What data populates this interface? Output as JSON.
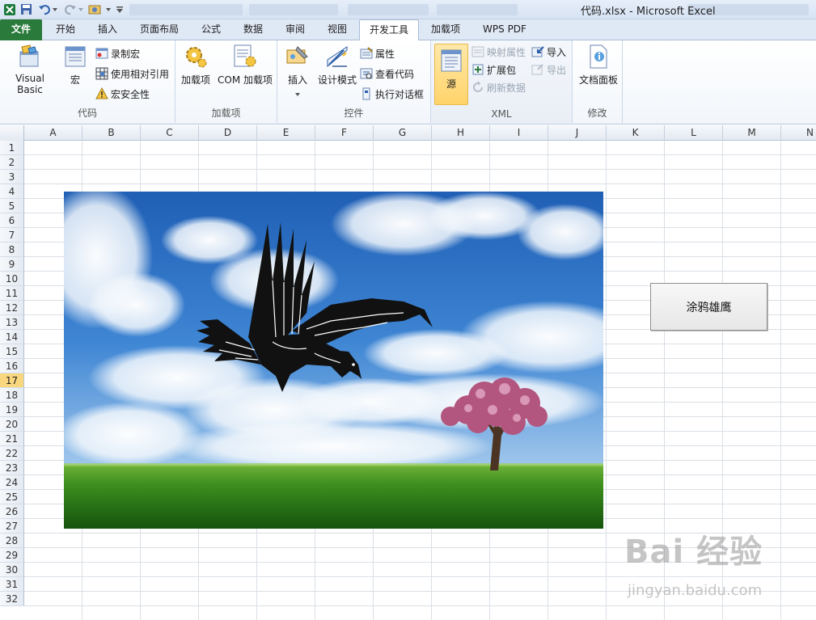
{
  "titlebar": {
    "title": "代码.xlsx  -  Microsoft Excel"
  },
  "tabs": {
    "file": "文件",
    "items": [
      "开始",
      "插入",
      "页面布局",
      "公式",
      "数据",
      "审阅",
      "视图",
      "开发工具",
      "加载项",
      "WPS PDF"
    ],
    "active": "开发工具"
  },
  "ribbon": {
    "code": {
      "label": "代码",
      "visual_basic": "Visual Basic",
      "macros": "宏",
      "record_macro": "录制宏",
      "use_relative": "使用相对引用",
      "macro_security": "宏安全性"
    },
    "addins": {
      "label": "加载项",
      "addins": "加载项",
      "com_addins": "COM 加载项"
    },
    "controls": {
      "label": "控件",
      "insert": "插入",
      "design_mode": "设计模式",
      "properties": "属性",
      "view_code": "查看代码",
      "run_dialog": "执行对话框"
    },
    "xml": {
      "label": "XML",
      "source": "源",
      "map_properties": "映射属性",
      "expansion_packs": "扩展包",
      "refresh_data": "刷新数据",
      "import": "导入",
      "export": "导出"
    },
    "modify": {
      "label": "修改",
      "document_panel": "文档面板"
    }
  },
  "grid": {
    "columns": [
      "A",
      "B",
      "C",
      "D",
      "E",
      "F",
      "G",
      "H",
      "I",
      "J",
      "K",
      "L",
      "M",
      "N"
    ],
    "rows": [
      "1",
      "2",
      "3",
      "4",
      "5",
      "6",
      "7",
      "8",
      "9",
      "10",
      "11",
      "12",
      "13",
      "14",
      "15",
      "16",
      "17",
      "18",
      "19",
      "20",
      "21",
      "22",
      "23",
      "24",
      "25",
      "26",
      "27",
      "28",
      "29",
      "30",
      "31",
      "32"
    ],
    "selected_row": "17"
  },
  "sheet": {
    "macro_button_label": "涂鸦雄鹰"
  },
  "watermark": {
    "brand": "Bai 经验",
    "url": "jingyan.baidu.com"
  },
  "colors": {
    "file_tab": "#2a7a3c",
    "selected_row_header": "#f9d77e",
    "xml_source_highlight": "#ffd36a"
  }
}
